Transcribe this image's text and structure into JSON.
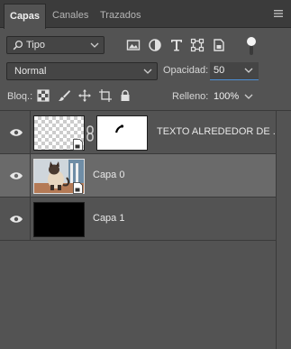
{
  "tabs": [
    {
      "label": "Capas",
      "active": true
    },
    {
      "label": "Canales",
      "active": false
    },
    {
      "label": "Trazados",
      "active": false
    }
  ],
  "filter": {
    "kind_label": "Tipo",
    "icons": [
      "image-filter-icon",
      "adjustment-filter-icon",
      "type-filter-icon",
      "shape-filter-icon",
      "smart-object-filter-icon"
    ]
  },
  "blend": {
    "mode": "Normal",
    "opacity_label": "Opacidad:",
    "opacity_value": "50"
  },
  "lock": {
    "label": "Bloq.:",
    "fill_label": "Relleno:",
    "fill_value": "100%"
  },
  "layers": [
    {
      "name": "TEXTO ALREDEDOR DE ...",
      "visible": true,
      "selected": false,
      "has_mask": true
    },
    {
      "name": "Capa 0",
      "visible": true,
      "selected": true,
      "has_mask": false
    },
    {
      "name": "Capa 1",
      "visible": true,
      "selected": false,
      "has_mask": false
    }
  ],
  "colors": {
    "panel_bg": "#535353",
    "tab_bar_bg": "#3b3b3b",
    "selected_row": "#6a6a6a",
    "accent": "#4d8fd6"
  }
}
